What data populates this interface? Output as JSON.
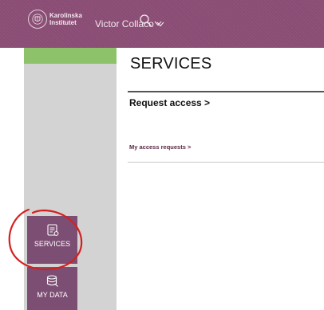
{
  "header": {
    "logo": {
      "line1": "Karolinska",
      "line2": "Institutet",
      "icon": "seal-icon"
    },
    "user_name": "Victor Collaco",
    "user_menu_icon": "chevron-down-icon",
    "search_icon": "search-icon",
    "search_menu_icon": "chevron-down-icon"
  },
  "sidebar": {
    "items": [
      {
        "label": "SERVICES",
        "icon": "services-icon",
        "selected": true
      },
      {
        "label": "MY DATA",
        "icon": "database-icon",
        "selected": false
      }
    ]
  },
  "main": {
    "title": "SERVICES",
    "request_access": "Request access >",
    "my_access_requests": "My access requests >"
  },
  "colors": {
    "brand_purple": "#8a4c74",
    "nav_item": "#7d4e73",
    "accent_green": "#8dc26a",
    "annotation_red": "#d42020"
  }
}
